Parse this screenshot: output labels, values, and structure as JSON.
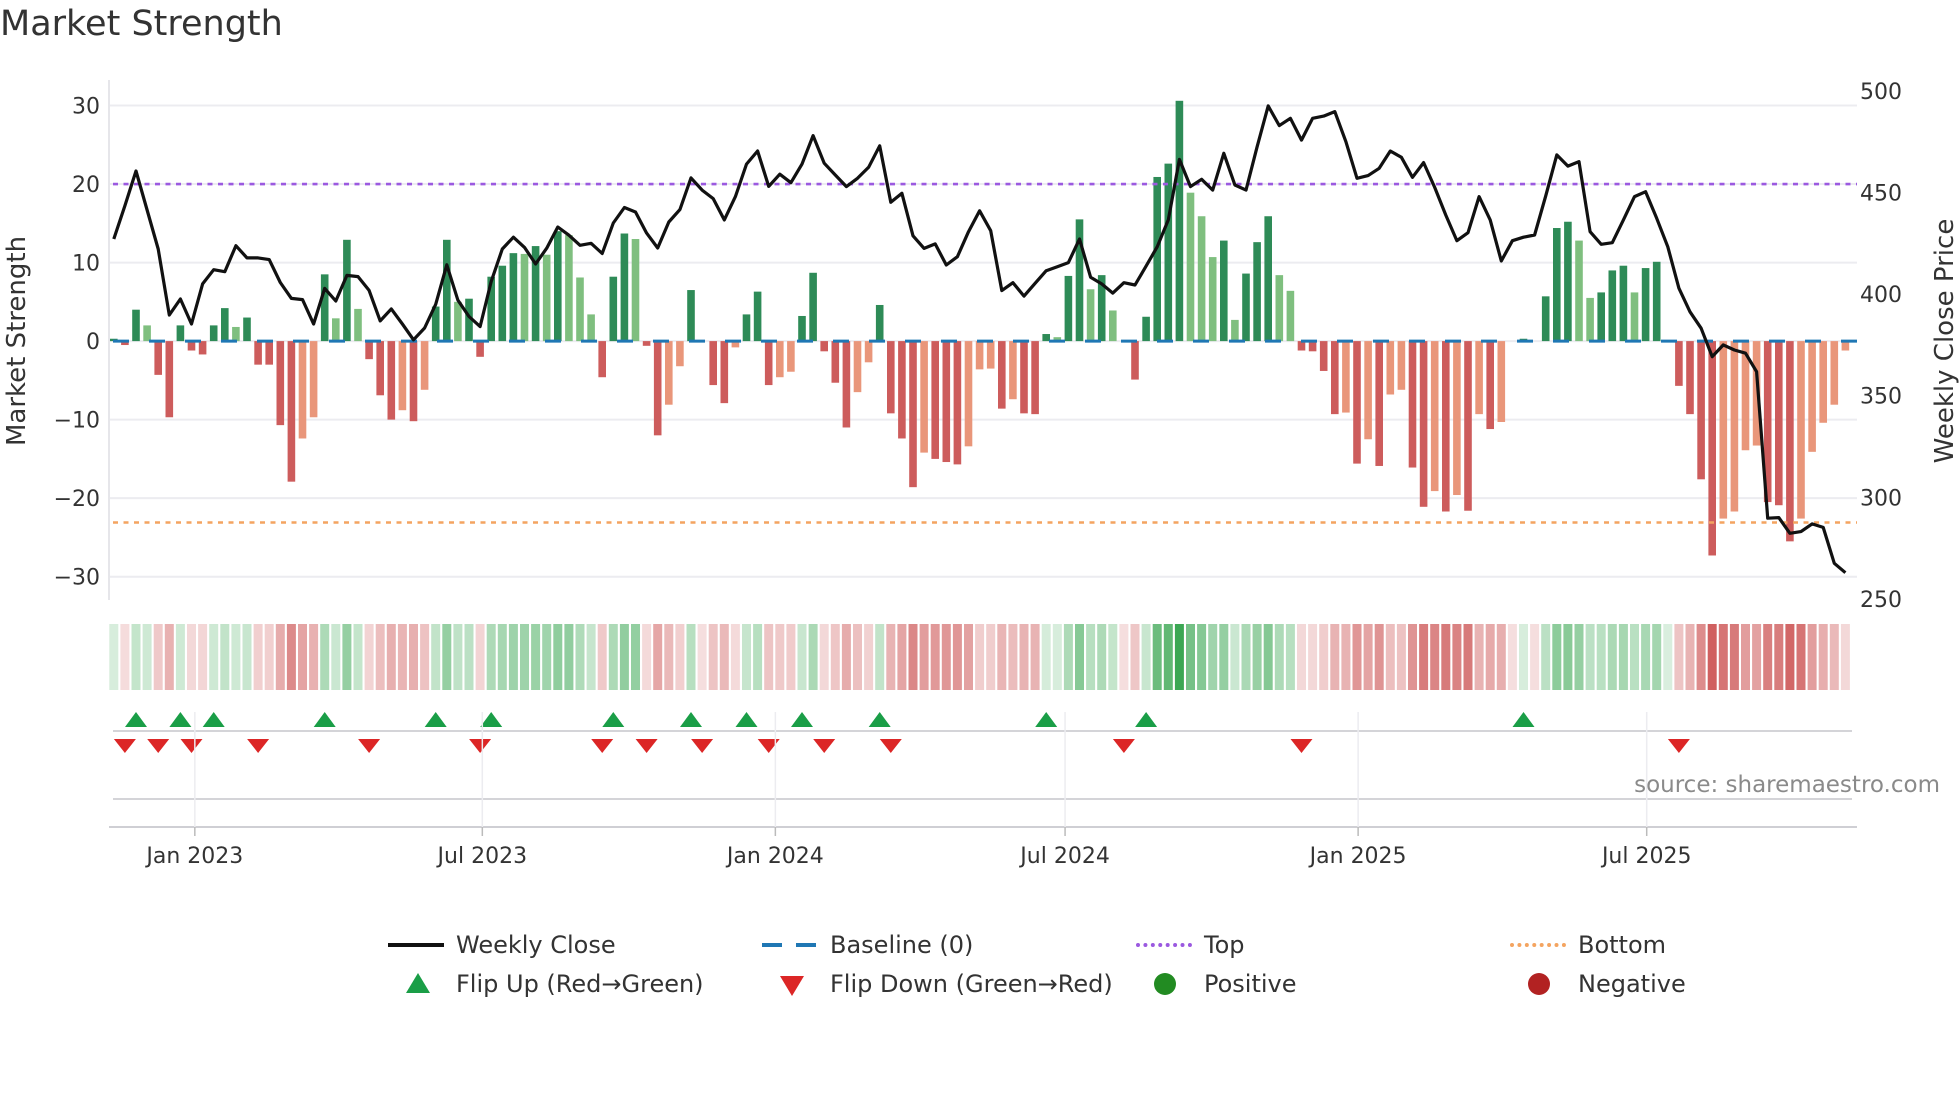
{
  "title": "Market Strength",
  "source": "source: sharemaestro.com",
  "legend": {
    "weekly_close": "Weekly Close",
    "baseline": "Baseline (0)",
    "top": "Top",
    "bottom": "Bottom",
    "flip_up": "Flip Up (Red→Green)",
    "flip_down": "Flip Down (Green→Red)",
    "positive": "Positive",
    "negative": "Negative"
  },
  "colors": {
    "pos_strong": "#2e8b57",
    "pos_weak": "#7fbf7f",
    "neg_strong": "#cd5c5c",
    "neg_weak": "#e9967a",
    "line": "#111111",
    "baseline": "#1f77b4",
    "top": "#9b59e0",
    "bottom": "#f4a460",
    "flip_up": "#1a9e47",
    "flip_down": "#dc2626",
    "positive": "#228b22",
    "negative": "#b22222"
  },
  "chart_data": {
    "type": "bar",
    "title": "Market Strength",
    "ylabel": "Market Strength",
    "y2label": "Weekly Close Price",
    "ylim": [
      -33,
      33
    ],
    "y2lim": [
      249.5,
      505.4
    ],
    "yticks": [
      "30",
      "20",
      "10",
      "0",
      "−10",
      "−20",
      "−30"
    ],
    "ytick_values": [
      30,
      20,
      10,
      0,
      -10,
      -20,
      -30
    ],
    "y2ticks": [
      "500",
      "450",
      "400",
      "350",
      "300",
      "250"
    ],
    "y2tick_values": [
      500,
      450,
      400,
      350,
      300,
      250
    ],
    "xticks": [
      {
        "label": "Jan 2023",
        "week": 7.3
      },
      {
        "label": "Jul 2023",
        "week": 33.2
      },
      {
        "label": "Jan 2024",
        "week": 59.6
      },
      {
        "label": "Jul 2024",
        "week": 85.7
      },
      {
        "label": "Jan 2025",
        "week": 112.1
      },
      {
        "label": "Jul 2025",
        "week": 138.1
      }
    ],
    "top_threshold": 20,
    "bottom_threshold": -23.1,
    "baseline": 0,
    "strength": [
      0.3,
      -0.5,
      4.0,
      2.0,
      -4.3,
      -9.7,
      2.0,
      -1.2,
      -1.7,
      2.0,
      4.2,
      1.8,
      3.0,
      -3.0,
      -3.0,
      -10.7,
      -17.9,
      -12.4,
      -9.7,
      8.5,
      2.9,
      12.9,
      4.1,
      -2.3,
      -6.9,
      -10.0,
      -8.8,
      -10.2,
      -6.2,
      4.4,
      12.9,
      5.0,
      5.4,
      -2.0,
      8.2,
      9.6,
      11.2,
      11.1,
      12.1,
      11.0,
      14.0,
      13.5,
      8.1,
      3.4,
      -4.6,
      8.2,
      13.7,
      13.0,
      -0.6,
      -12.0,
      -8.1,
      -3.2,
      6.5,
      0,
      -5.6,
      -7.9,
      -0.8,
      3.4,
      6.3,
      -5.6,
      -4.6,
      -3.9,
      3.2,
      8.7,
      -1.3,
      -5.3,
      -11.0,
      -6.5,
      -2.7,
      4.6,
      -9.2,
      -12.4,
      -18.6,
      -14.2,
      -15.0,
      -15.4,
      -15.7,
      -13.4,
      -3.6,
      -3.5,
      -8.6,
      -7.4,
      -9.2,
      -9.3,
      0.9,
      0.5,
      8.3,
      15.5,
      6.6,
      8.4,
      3.9,
      0,
      -4.9,
      3.1,
      20.9,
      22.6,
      30.6,
      18.9,
      15.9,
      10.7,
      12.8,
      2.7,
      8.6,
      12.6,
      15.9,
      8.4,
      6.4,
      -1.2,
      -1.3,
      -3.8,
      -9.3,
      -9.1,
      -15.6,
      -12.5,
      -15.9,
      -6.8,
      -6.2,
      -16.1,
      -21.1,
      -19.1,
      -21.7,
      -19.6,
      -21.6,
      -9.3,
      -11.2,
      -10.3,
      0,
      0.3,
      0,
      5.7,
      14.4,
      15.2,
      12.8,
      5.5,
      6.2,
      9.0,
      9.6,
      6.2,
      9.3,
      10.1,
      0.1,
      -5.7,
      -9.3,
      -17.6,
      -27.3,
      -22.6,
      -21.7,
      -13.9,
      -13.3,
      -20.5,
      -20.9,
      -25.5,
      -22.6,
      -14.1,
      -10.4,
      -8.1,
      -1.2
    ],
    "weekly_close": [
      427.1,
      443.5,
      460.6,
      441.4,
      422.2,
      389.7,
      397.6,
      385.3,
      405,
      412,
      411,
      423.8,
      417.8,
      417.8,
      417,
      405.7,
      397.9,
      397.3,
      385.3,
      402.8,
      396.6,
      409.2,
      408.6,
      401.8,
      386.8,
      392.7,
      385.3,
      377.5,
      383.3,
      395,
      414.4,
      397,
      389,
      384,
      406.2,
      422.2,
      428,
      423,
      414.8,
      422.6,
      433,
      429,
      424,
      425,
      420,
      435,
      442.6,
      440.4,
      430,
      422.7,
      435.5,
      441.6,
      457.2,
      451.2,
      447,
      436.5,
      448,
      464,
      470.4,
      453,
      459,
      454.8,
      464,
      478,
      464.4,
      458.6,
      452.9,
      457,
      462.4,
      473,
      445.2,
      449.6,
      428.7,
      422.5,
      424.7,
      414.3,
      418.4,
      430.7,
      441,
      431.2,
      401.7,
      405.6,
      399,
      405.3,
      411.5,
      413.5,
      415.5,
      427.1,
      408.3,
      405,
      400.5,
      405.6,
      404.5,
      413.8,
      423.3,
      436.5,
      466.3,
      452.9,
      456.5,
      451.2,
      469.3,
      453.7,
      451.2,
      472.5,
      492.6,
      482.9,
      486.5,
      475.8,
      486.5,
      487.6,
      489.8,
      475,
      457,
      458.3,
      461.9,
      470.4,
      467.3,
      457.5,
      464.7,
      452.5,
      438.9,
      426.3,
      430.2,
      448,
      436.5,
      416.3,
      426.3,
      428,
      429.1,
      448.3,
      468.5,
      463,
      465.2,
      430.7,
      424.5,
      425.3,
      436.5,
      448,
      450.4,
      437.3,
      423.3,
      402.9,
      391.3,
      383.2,
      369.2,
      375,
      372.5,
      370.9,
      361.8,
      289.7,
      290,
      282.3,
      283.1,
      286.9,
      285.2,
      267.5,
      262.9
    ],
    "flip_up_weeks": [
      2,
      6,
      9,
      19,
      29,
      34,
      45,
      52,
      57,
      62,
      69,
      84,
      93,
      127
    ],
    "flip_down_weeks": [
      1,
      4,
      7,
      13,
      23,
      33,
      44,
      48,
      53,
      59,
      64,
      70,
      91,
      107,
      141
    ]
  }
}
